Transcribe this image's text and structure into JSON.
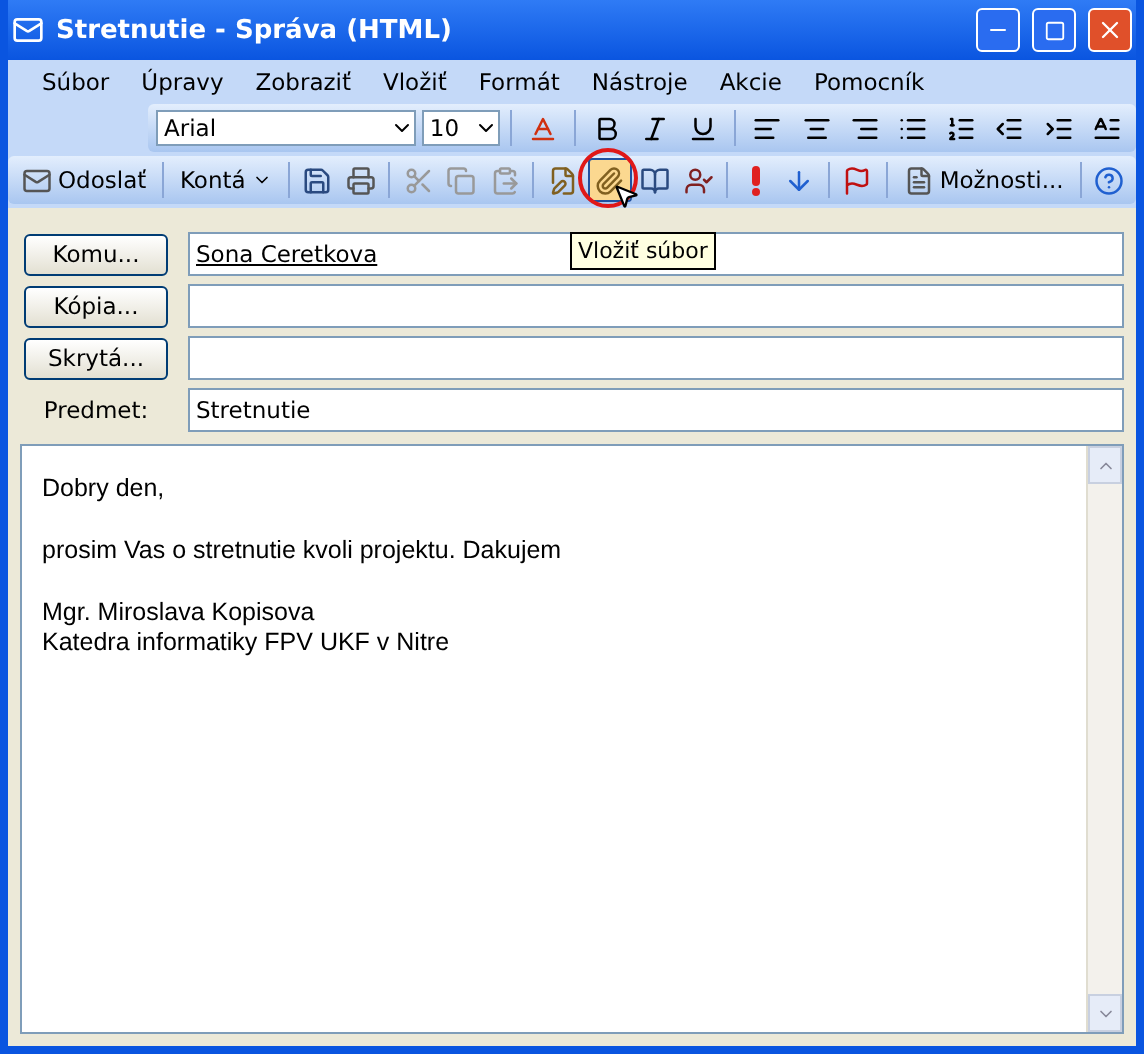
{
  "window": {
    "title": "Stretnutie - Správa (HTML)"
  },
  "menu": [
    {
      "label": "Súbor"
    },
    {
      "label": "Úpravy"
    },
    {
      "label": "Zobraziť"
    },
    {
      "label": "Vložiť"
    },
    {
      "label": "Formát"
    },
    {
      "label": "Nástroje"
    },
    {
      "label": "Akcie"
    },
    {
      "label": "Pomocník"
    }
  ],
  "format_toolbar": {
    "font": "Arial",
    "size": "10"
  },
  "standard_toolbar": {
    "send": "Odoslať",
    "accounts": "Kontá",
    "options": "Možnosti...",
    "attach_highlighted": true,
    "tooltip": "Vložiť súbor"
  },
  "header_fields": [
    {
      "kind": "button",
      "label": "Komu...",
      "value": "Sona Ceretkova",
      "resolved": true
    },
    {
      "kind": "button",
      "label": "Kópia..."
    },
    {
      "kind": "button",
      "label": "Skrytá..."
    },
    {
      "kind": "label",
      "label": "Predmet:",
      "value": "Stretnutie",
      "resolved": false
    }
  ],
  "body": {
    "paragraphs": [
      {
        "lines": [
          "Dobry den,"
        ]
      },
      {
        "lines": [
          "prosim Vas o stretnutie kvoli projektu. Dakujem"
        ]
      },
      {
        "lines": [
          "Mgr. Miroslava Kopisova",
          "Katedra informatiky FPV UKF v Nitre"
        ]
      }
    ]
  }
}
